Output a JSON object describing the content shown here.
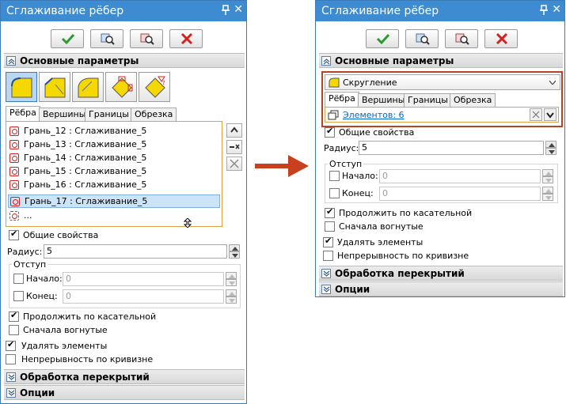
{
  "dialog": {
    "title": "Сглаживание рёбер",
    "pin_icon": "pin-icon",
    "close_symbol": "✕"
  },
  "toolbar": [
    "ok-check-icon",
    "preview-icon",
    "preview-detail-icon",
    "cancel-icon"
  ],
  "sections": {
    "main": "Основные параметры",
    "overlap": "Обработка перекрытий",
    "options": "Опции"
  },
  "tabs": [
    "Рёбра",
    "Вершины",
    "Границы",
    "Обрезка"
  ],
  "faces": [
    "Грань_12 : Сглаживание_5",
    "Грань_13 : Сглаживание_5",
    "Грань_14 : Сглаживание_5",
    "Грань_15 : Сглаживание_5",
    "Грань_16 : Сглаживание_5",
    "Грань_17 : Сглаживание_5",
    "..."
  ],
  "selected_face_index": 5,
  "general_props": "Общие свойства",
  "radius": {
    "label": "Радиус:",
    "value": "5"
  },
  "offset": {
    "label": "Отступ",
    "start_label": "Начало:",
    "start_value": "0",
    "end_label": "Конец:",
    "end_value": "0"
  },
  "checks": {
    "tangent": "Продолжить по касательной",
    "concave": "Сначала вогнутые",
    "delete": "Удалять элементы",
    "continuity": "Непрерывность по кривизне"
  },
  "right": {
    "combo_value": "Скругление",
    "elements_link": "Элементов: 6"
  },
  "colors": {
    "titlebar": "#3d8bd1",
    "highlight": "#b5432a",
    "arrow": "#c8401e",
    "selection": "#cce4f7"
  }
}
